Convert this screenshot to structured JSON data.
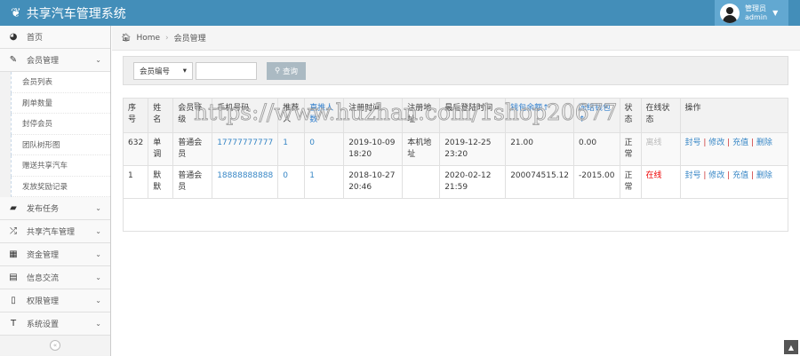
{
  "app": {
    "title": "共享汽车管理系统",
    "user_role": "管理员",
    "user_name": "admin"
  },
  "sidebar": {
    "items": [
      {
        "label": "首页",
        "icon": "dashboard-icon"
      },
      {
        "label": "会员管理",
        "icon": "edit-icon",
        "expanded": true,
        "children": [
          "会员列表",
          "刷单数量",
          "封停会员",
          "团队树形图",
          "赠送共享汽车",
          "发放奖励记录"
        ]
      },
      {
        "label": "发布任务",
        "icon": "book-icon"
      },
      {
        "label": "共享汽车管理",
        "icon": "shuffle-icon"
      },
      {
        "label": "资金管理",
        "icon": "calendar-icon"
      },
      {
        "label": "信息交流",
        "icon": "list-alt-icon"
      },
      {
        "label": "权限管理",
        "icon": "file-icon"
      },
      {
        "label": "系统设置",
        "icon": "text-icon"
      }
    ]
  },
  "breadcrumb": {
    "home": "Home",
    "current": "会员管理"
  },
  "search": {
    "select_value": "会员编号",
    "input_value": "",
    "button": "查询"
  },
  "table": {
    "headers": [
      "序号",
      "姓名",
      "会员等级",
      "手机号码",
      "推荐人",
      "直推人数",
      "注册时间",
      "注册地址",
      "最后登陆时间",
      "钱包余额↑",
      "冻结钱包↑",
      "状态",
      "在线状态",
      "操作"
    ],
    "rows": [
      {
        "id": "632",
        "name": "单调",
        "level": "普通会员",
        "phone": "17777777777",
        "referrer": "1",
        "direct": "0",
        "reg_time": "2019-10-09 18:20",
        "reg_addr": "本机地址",
        "last_login": "2019-12-25 23:20",
        "balance": "21.00",
        "frozen": "0.00",
        "status": "正常",
        "online": "离线",
        "online_flag": false
      },
      {
        "id": "1",
        "name": "默默",
        "level": "普通会员",
        "phone": "18888888888",
        "referrer": "0",
        "direct": "1",
        "reg_time": "2018-10-27 20:46",
        "reg_addr": "",
        "last_login": "2020-02-12 21:59",
        "balance": "200074515.12",
        "frozen": "-2015.00",
        "status": "正常",
        "online": "在线",
        "online_flag": true
      }
    ],
    "actions": [
      "封号",
      "修改",
      "充值",
      "删除"
    ]
  },
  "watermark": "https://www.huzhan.com/1shop20677",
  "colors": {
    "header": "#438eb9",
    "link": "#3887c6",
    "online": "#ee0000"
  }
}
